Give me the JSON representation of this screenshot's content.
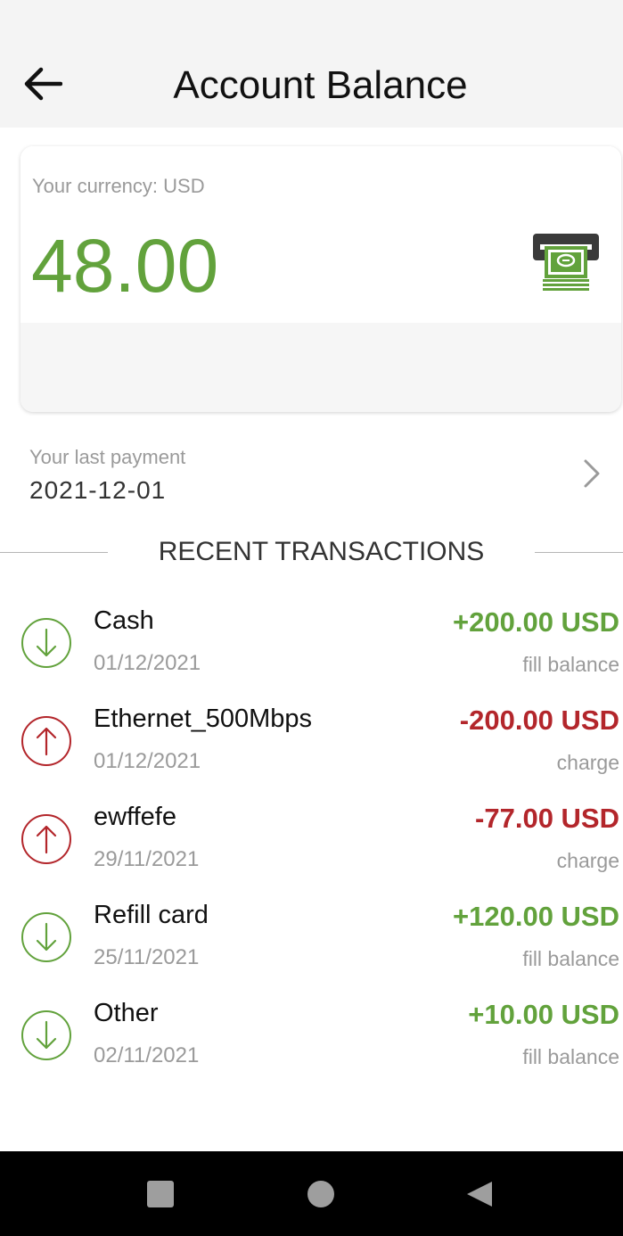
{
  "header": {
    "title": "Account Balance",
    "back_icon": "arrow-left-icon"
  },
  "balance_card": {
    "currency_label": "Your currency: USD",
    "balance": "48.00",
    "icon": "atm-cash-icon",
    "balance_color": "#62a23c"
  },
  "last_payment": {
    "label": "Your last payment",
    "date": "2021-12-01",
    "icon": "chevron-right-icon"
  },
  "section": {
    "title": "RECENT TRANSACTIONS"
  },
  "transactions": [
    {
      "name": "Cash",
      "date": "01/12/2021",
      "amount": "+200.00 USD",
      "type": "fill balance",
      "direction": "in",
      "icon": "arrow-down-circle-icon"
    },
    {
      "name": "Ethernet_500Mbps",
      "date": "01/12/2021",
      "amount": "-200.00 USD",
      "type": "charge",
      "direction": "out",
      "icon": "arrow-up-circle-icon"
    },
    {
      "name": "ewffefe",
      "date": "29/11/2021",
      "amount": "-77.00 USD",
      "type": "charge",
      "direction": "out",
      "icon": "arrow-up-circle-icon"
    },
    {
      "name": "Refill card",
      "date": "25/11/2021",
      "amount": "+120.00 USD",
      "type": "fill balance",
      "direction": "in",
      "icon": "arrow-down-circle-icon"
    },
    {
      "name": "Other",
      "date": "02/11/2021",
      "amount": "+10.00 USD",
      "type": "fill balance",
      "direction": "in",
      "icon": "arrow-down-circle-icon"
    }
  ],
  "colors": {
    "income": "#62a23c",
    "expense": "#b3262b"
  },
  "navbar": {
    "recent_icon": "square-icon",
    "home_icon": "circle-icon",
    "back_icon": "triangle-back-icon"
  }
}
